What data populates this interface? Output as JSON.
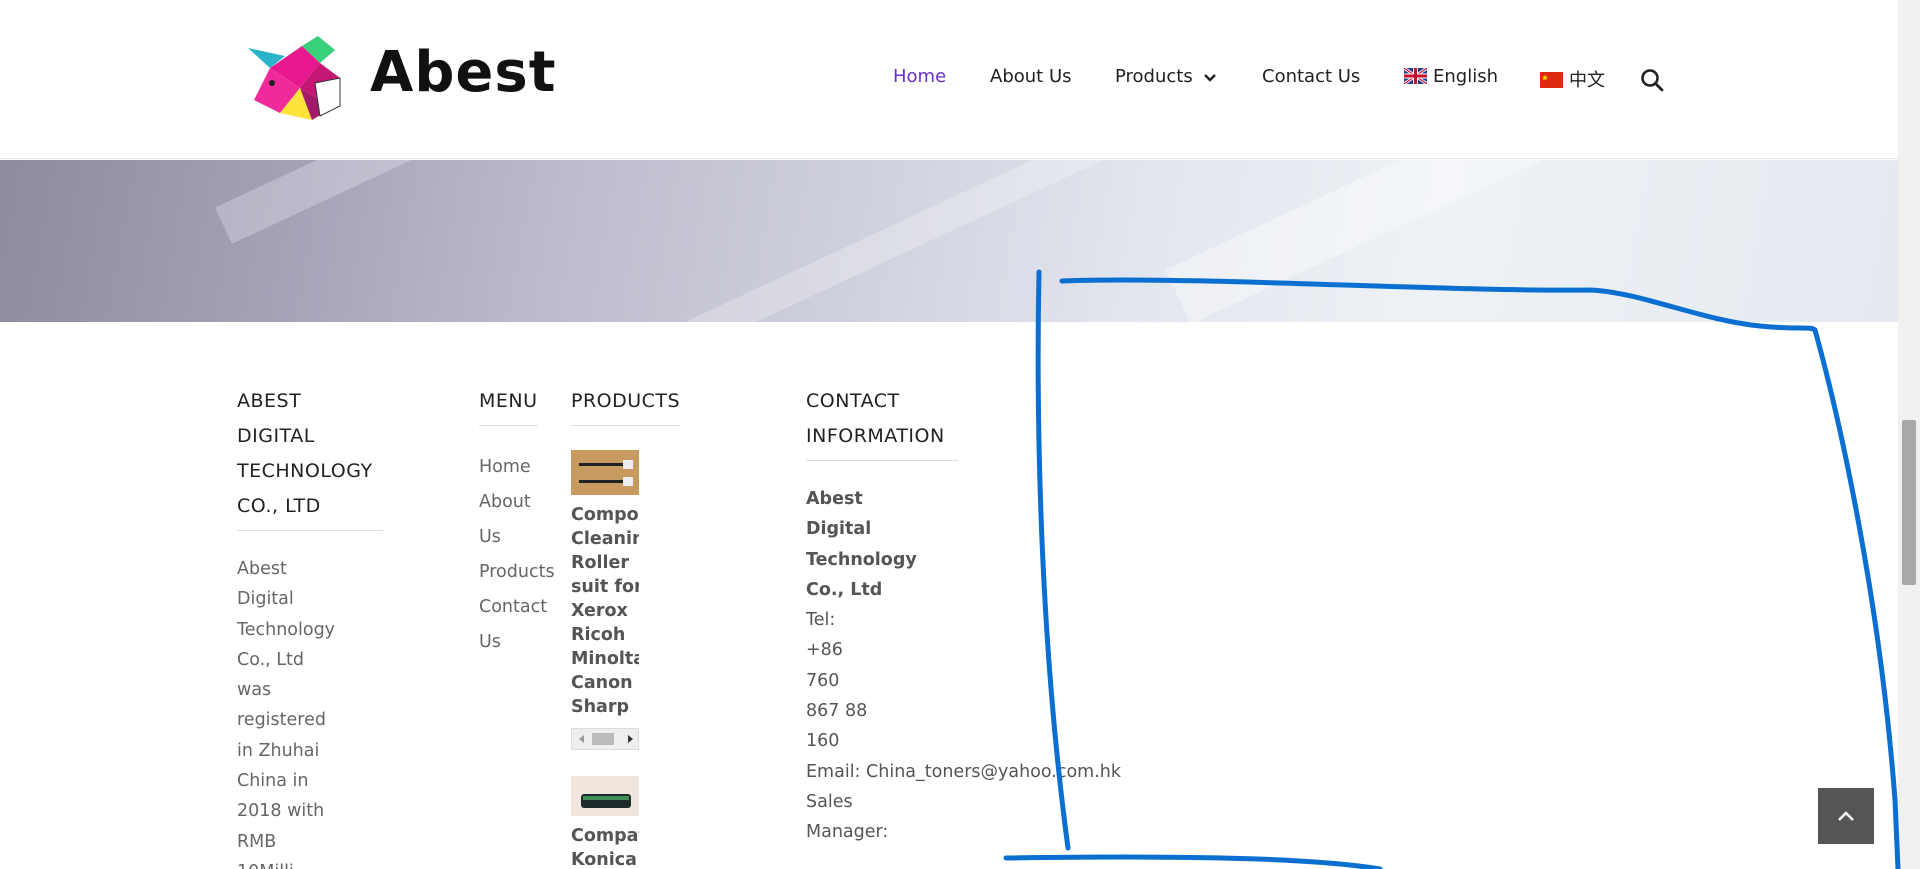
{
  "header": {
    "logo_text": "Abest",
    "nav": [
      {
        "label": "Home",
        "active": true
      },
      {
        "label": "About Us"
      },
      {
        "label": "Products"
      },
      {
        "label": "Contact Us"
      },
      {
        "label": "English"
      },
      {
        "label": "中文"
      }
    ],
    "icons": {
      "search": "search-icon",
      "products_caret": "chevron-down-icon",
      "uk_flag": "uk-flag-icon",
      "cn_flag": "china-flag-icon"
    }
  },
  "footer": {
    "company": {
      "title": "ABEST DIGITAL TECHNOLOGY CO., LTD",
      "description": "Abest Digital Technology Co., Ltd was registered in Zhuhai China in 2018 with RMB 10Milli"
    },
    "menu": {
      "title": "MENU",
      "links": [
        "Home",
        "About Us",
        "Products",
        "Contact Us"
      ]
    },
    "products": {
      "title": "PRODUCTS",
      "items": [
        {
          "title": "Compor Cleaning Roller suit for Xerox Ricoh Minolta Canon Sharp"
        },
        {
          "title": "Compat Konica"
        }
      ]
    },
    "contact": {
      "title": "CONTACT INFORMATION",
      "company_name": "Abest Digital Technology Co., Ltd",
      "tel": "Tel: +86 760 867 88 160",
      "email_label": "Email:",
      "email": "China_toners@yahoo.com.hk",
      "sales": "Sales Manager:"
    }
  },
  "colors": {
    "accent": "#6a2fc7",
    "annotation": "#0a6fd1",
    "back_to_top": "#555555"
  }
}
